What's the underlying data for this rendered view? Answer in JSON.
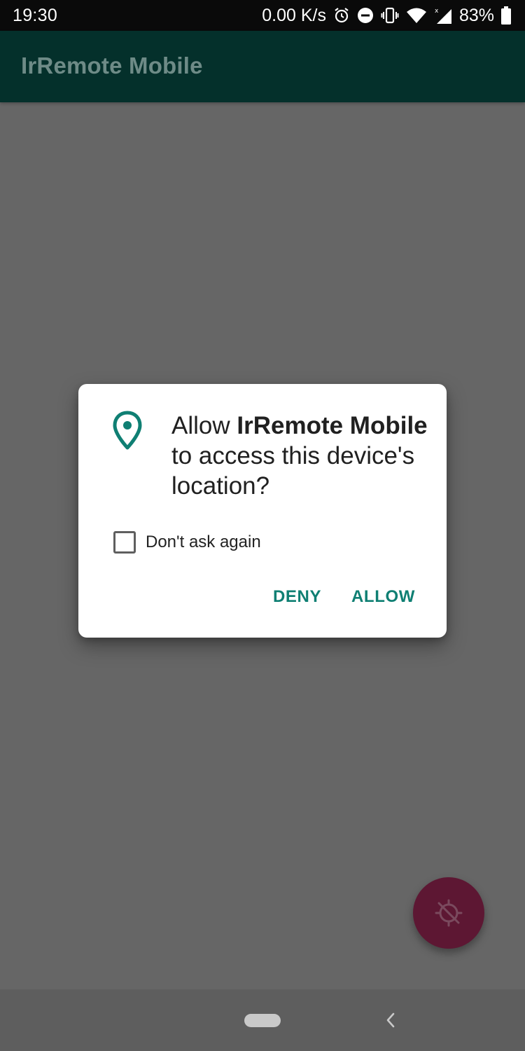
{
  "status_bar": {
    "time": "19:30",
    "net_speed": "0.00 K/s",
    "battery": "83%",
    "icons": [
      "alarm-icon",
      "do-not-disturb-icon",
      "vibrate-icon",
      "wifi-icon",
      "signal-icon",
      "battery-icon"
    ]
  },
  "app_bar": {
    "title": "IrRemote Mobile"
  },
  "dialog": {
    "icon": "location-pin-icon",
    "message_prefix": "Allow ",
    "app_name": "IrRemote Mobile",
    "message_suffix": " to access this device's location?",
    "checkbox_label": "Don't ask again",
    "checkbox_checked": false,
    "deny_label": "DENY",
    "allow_label": "ALLOW"
  },
  "fab": {
    "icon": "location-off-icon"
  },
  "nav_bar": {
    "icons": [
      "home-pill-icon",
      "back-icon"
    ]
  },
  "colors": {
    "accent": "#0f7f73",
    "app_bar": "#04302b",
    "scrim": "#666666",
    "fab": "#5d1733"
  }
}
